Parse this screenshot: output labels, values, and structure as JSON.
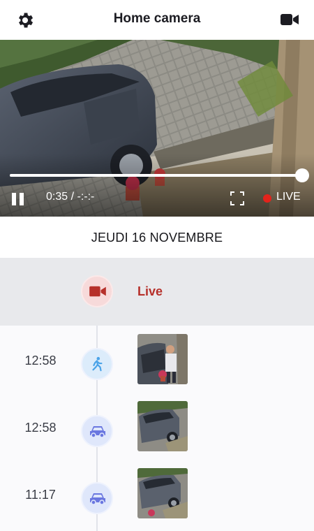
{
  "header": {
    "title": "Home camera",
    "settings_icon": "gear-icon",
    "camera_icon": "video-camera-icon"
  },
  "player": {
    "current_time": "0:35",
    "separator": "/",
    "duration": "-:-:-",
    "live_label": "LIVE",
    "progress": 1.0,
    "state": "playing"
  },
  "date_heading": "JEUDI 16 NOVEMBRE",
  "timeline": {
    "live": {
      "label": "Live",
      "icon": "video-camera-icon",
      "color": "#b6302a"
    },
    "events": [
      {
        "time": "12:58",
        "type": "person",
        "icon": "walking-person-icon"
      },
      {
        "time": "12:58",
        "type": "vehicle",
        "icon": "car-icon"
      },
      {
        "time": "11:17",
        "type": "vehicle",
        "icon": "car-icon"
      }
    ]
  },
  "colors": {
    "live_red": "#e3231b",
    "live_text": "#b6302a",
    "person_icon": "#4ba3e8",
    "vehicle_icon": "#6a77e0"
  }
}
